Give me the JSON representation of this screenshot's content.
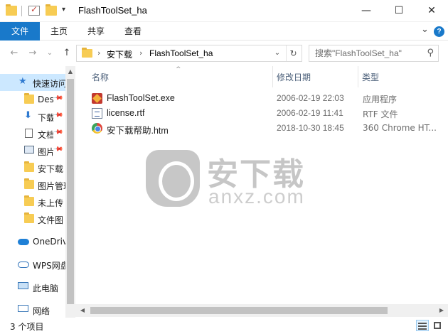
{
  "window": {
    "title": "FlashToolSet_ha",
    "minimize": "—",
    "maximize": "☐",
    "close": "✕"
  },
  "ribbon": {
    "tabs": [
      "文件",
      "主页",
      "共享",
      "查看"
    ],
    "expand": "⌄",
    "help": "?"
  },
  "nav": {
    "back": "←",
    "forward": "→",
    "recent": "⌄",
    "up": "↑",
    "breadcrumb": [
      "安下载",
      "FlashToolSet_ha"
    ],
    "separator": "›",
    "dropdown": "⌄",
    "refresh": "↻",
    "search_placeholder": "搜索\"FlashToolSet_ha\"",
    "search_icon": "⚲"
  },
  "sidebar": {
    "items": [
      {
        "label": "快速访问",
        "icon": "star-icon",
        "selected": true
      },
      {
        "label": "Desktop",
        "icon": "folder-icon",
        "pinned": true
      },
      {
        "label": "下载",
        "icon": "download-icon",
        "pinned": true
      },
      {
        "label": "文档",
        "icon": "document-icon",
        "pinned": true
      },
      {
        "label": "图片",
        "icon": "picture-icon",
        "pinned": true
      },
      {
        "label": "安下载",
        "icon": "folder-icon"
      },
      {
        "label": "图片管理",
        "icon": "folder-icon"
      },
      {
        "label": "未上传",
        "icon": "folder-icon"
      },
      {
        "label": "文件图",
        "icon": "folder-icon"
      },
      {
        "label": "OneDrive",
        "icon": "cloud-icon"
      },
      {
        "label": "WPS网盘",
        "icon": "cloud-icon"
      },
      {
        "label": "此电脑",
        "icon": "computer-icon"
      },
      {
        "label": "网络",
        "icon": "network-icon"
      }
    ],
    "pin_glyph": "📌"
  },
  "columns": {
    "name": "名称",
    "date": "修改日期",
    "type": "类型",
    "sort_indicator": "^"
  },
  "files": [
    {
      "name": "FlashToolSet.exe",
      "date": "2006-02-19 22:03",
      "type": "应用程序",
      "icon": "exe-icon"
    },
    {
      "name": "license.rtf",
      "date": "2006-02-19 11:41",
      "type": "RTF 文件",
      "icon": "rtf-icon"
    },
    {
      "name": "安下载帮助.htm",
      "date": "2018-10-30 18:45",
      "type": "360 Chrome HT...",
      "icon": "chrome-icon"
    }
  ],
  "watermark": {
    "big": "安下载",
    "small": "anxz.com"
  },
  "scroll": {
    "up": "▲",
    "down": "▼",
    "left": "◀",
    "right": "▶"
  },
  "status": {
    "count": "3 个项目"
  },
  "colors": {
    "accent": "#1979ca",
    "selection": "#cce8ff"
  }
}
